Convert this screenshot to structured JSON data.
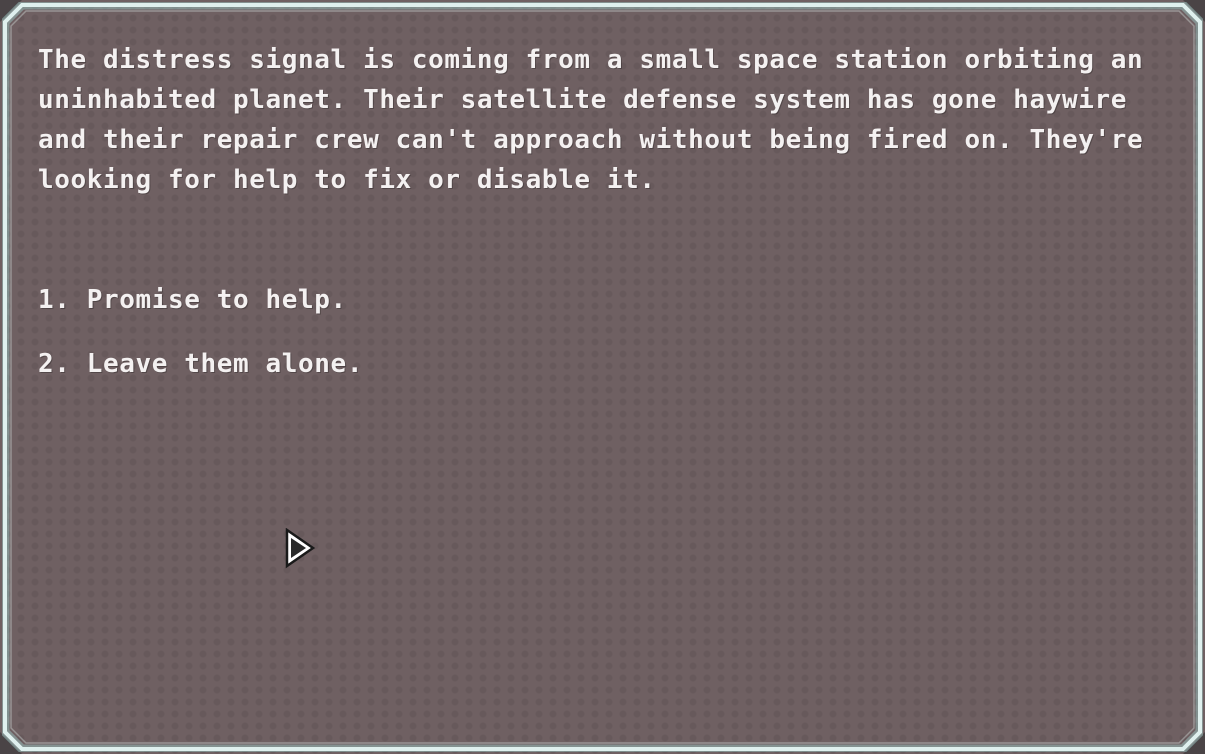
{
  "event": {
    "text": "The distress signal is coming from a small space station orbiting an uninhabited planet. Their satellite defense system has gone haywire and their repair crew can't approach without being fired on. They're looking for help to fix or disable it."
  },
  "choices": [
    {
      "label": "1. Promise to help."
    },
    {
      "label": "2. Leave them alone."
    }
  ],
  "colors": {
    "panel_fill": "#6f6062",
    "frame_border": "#d8ecea",
    "frame_glow": "#9fd1cc",
    "text": "#f4f1f1"
  },
  "icons": {
    "cursor": "mouse-pointer-icon"
  }
}
